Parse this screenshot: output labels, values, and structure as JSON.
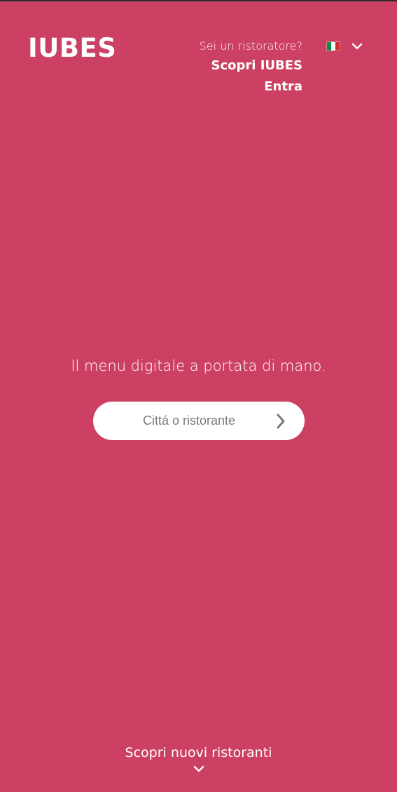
{
  "header": {
    "logo": "IUBES",
    "restaurateur_question": "Sei un ristoratore?",
    "discover_link": "Scopri IUBES",
    "login_link": "Entra",
    "language": {
      "selected_flag": "italy-flag-icon",
      "dropdown_icon": "chevron-down-icon"
    }
  },
  "hero": {
    "tagline": "Il menu digitale a portata di mano.",
    "search": {
      "placeholder": "Cittá o ristorante",
      "value": "",
      "submit_icon": "chevron-right-icon"
    }
  },
  "footer": {
    "cta_label": "Scopri nuovi ristoranti",
    "cta_icon": "chevron-down-icon"
  },
  "colors": {
    "background": "#cc4063",
    "text": "#ffffff",
    "search_background": "#ffffff",
    "placeholder": "#7a7a7a",
    "flag_green": "#009246",
    "flag_white": "#ffffff",
    "flag_red": "#ce2b37"
  }
}
